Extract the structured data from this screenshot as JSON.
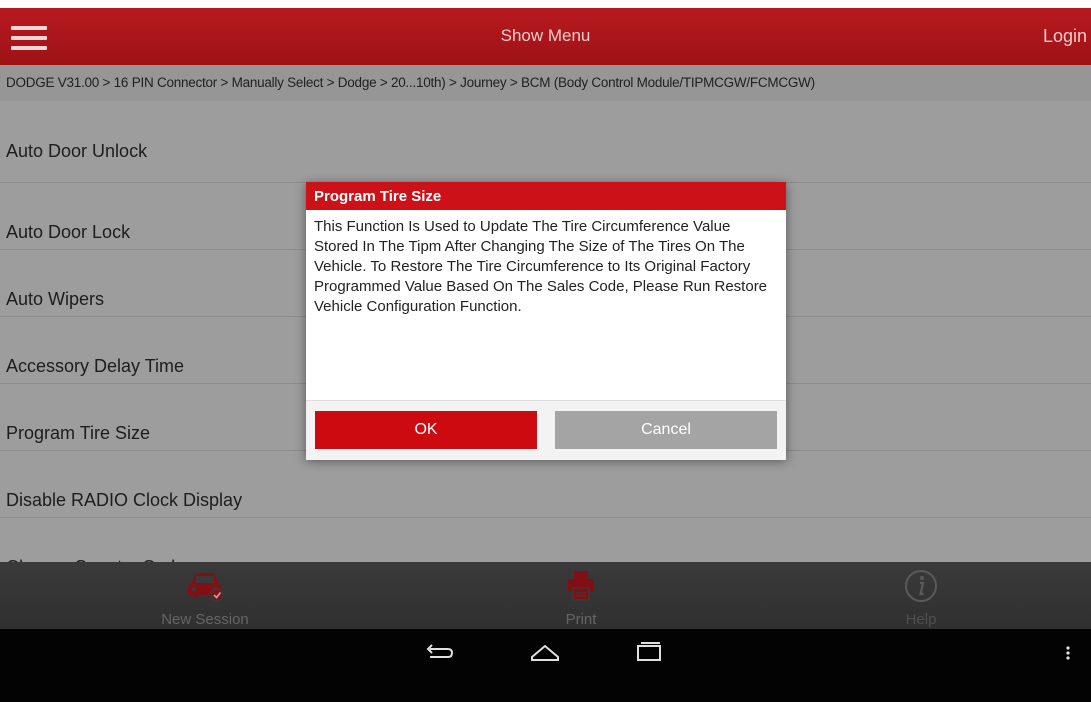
{
  "header": {
    "title": "Show Menu",
    "login_label": "Login"
  },
  "breadcrumb": "DODGE V31.00 > 16 PIN Connector > Manually Select > Dodge > 20...10th) > Journey > BCM (Body Control Module/TIPMCGW/FCMCGW)",
  "list": {
    "items": [
      "Auto Door Unlock",
      "Auto Door Lock",
      "Auto Wipers",
      "Accessory Delay Time",
      "Program Tire Size",
      "Disable RADIO Clock Display",
      "Change Country Code"
    ]
  },
  "dialog": {
    "title": "Program Tire Size",
    "message": "This Function Is Used to Update The Tire Circumference Value Stored In The Tipm After Changing The Size of The Tires On The Vehicle. To Restore The Tire Circumference to Its Original Factory Programmed Value Based On The Sales Code, Please Run Restore Vehicle Configuration Function.",
    "ok_label": "OK",
    "cancel_label": "Cancel"
  },
  "toolbar": {
    "new_session_label": "New Session",
    "print_label": "Print",
    "help_label": "Help"
  },
  "icons": {
    "menu": "hamburger-menu-icon",
    "new_session": "car-icon",
    "print": "printer-icon",
    "help": "info-icon",
    "back": "back-icon",
    "home": "home-icon",
    "recents": "recent-apps-icon",
    "overflow": "overflow-menu-icon"
  },
  "colors": {
    "brand_red": "#b71a1f",
    "dialog_red": "#cc1218",
    "ok_button": "#cc0a10",
    "cancel_button": "#a4a4a4"
  }
}
